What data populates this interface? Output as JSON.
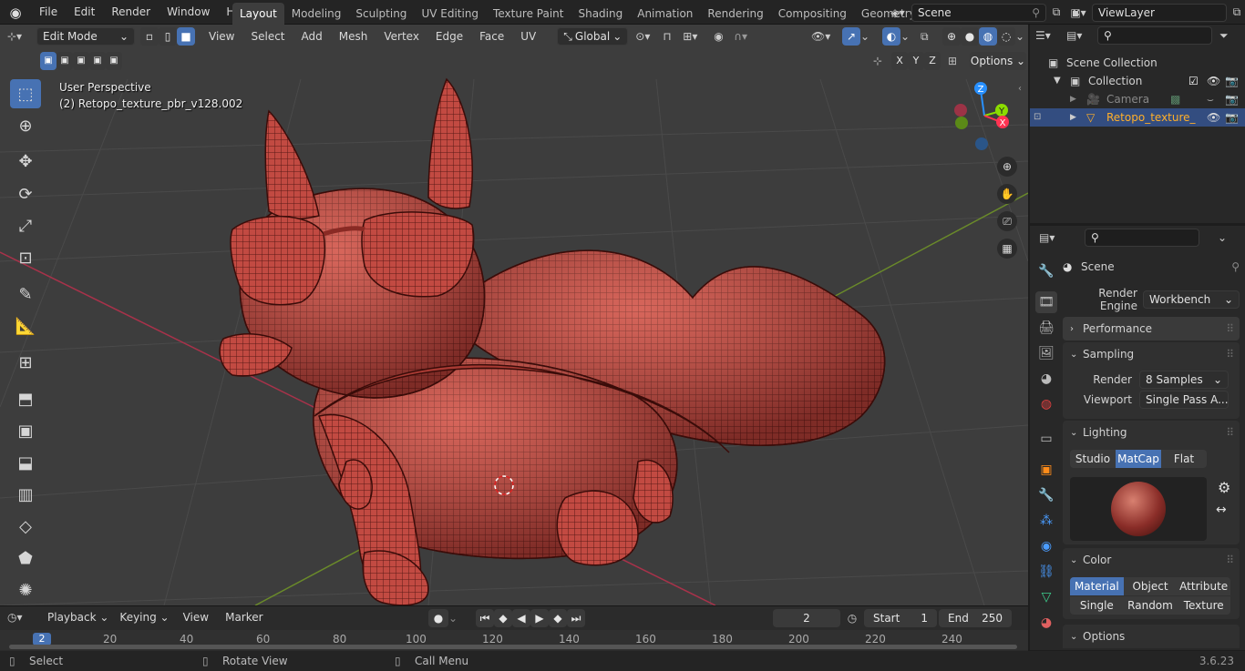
{
  "menu": {
    "items": [
      "File",
      "Edit",
      "Render",
      "Window",
      "Help"
    ]
  },
  "workspaces": {
    "tabs": [
      "Layout",
      "Modeling",
      "Sculpting",
      "UV Editing",
      "Texture Paint",
      "Shading",
      "Animation",
      "Rendering",
      "Compositing",
      "Geometry Noc"
    ],
    "active": "Layout"
  },
  "scene": {
    "name": "Scene",
    "view_layer": "ViewLayer"
  },
  "viewport_header": {
    "mode": "Edit Mode",
    "menus": [
      "View",
      "Select",
      "Add",
      "Mesh",
      "Vertex",
      "Edge",
      "Face",
      "UV"
    ],
    "orientation": "Global",
    "options": "Options",
    "axes": [
      "X",
      "Y",
      "Z"
    ]
  },
  "viewport": {
    "perspective": "User Perspective",
    "object_label": "(2) Retopo_texture_pbr_v128.002"
  },
  "gizmo": {
    "axes": [
      "Z",
      "Y",
      "X"
    ]
  },
  "outliner": {
    "root": "Scene Collection",
    "collection": "Collection",
    "camera": "Camera",
    "mesh": "Retopo_texture_"
  },
  "properties": {
    "breadcrumb": "Scene",
    "render_engine_label": "Render Engine",
    "render_engine": "Workbench",
    "performance": "Performance",
    "sampling": "Sampling",
    "render_label": "Render",
    "render_samples": "8 Samples",
    "viewport_label": "Viewport",
    "viewport_samples": "Single Pass A...",
    "lighting": "Lighting",
    "lighting_modes": [
      "Studio",
      "MatCap",
      "Flat"
    ],
    "lighting_active": "MatCap",
    "color": "Color",
    "color_modes_row1": [
      "Material",
      "Object",
      "Attribute"
    ],
    "color_modes_row2": [
      "Single",
      "Random",
      "Texture"
    ],
    "color_active": "Material",
    "options": "Options"
  },
  "timeline": {
    "menus": [
      "Playback",
      "Keying",
      "View",
      "Marker"
    ],
    "current_frame": "2",
    "start_label": "Start",
    "start": "1",
    "end_label": "End",
    "end": "250",
    "ruler": [
      "20",
      "40",
      "60",
      "80",
      "100",
      "120",
      "140",
      "160",
      "180",
      "200",
      "220",
      "240"
    ],
    "playhead": "2"
  },
  "status": {
    "select": "Select",
    "rotate": "Rotate View",
    "call_menu": "Call Menu",
    "version": "3.6.23"
  },
  "colors": {
    "accent": "#4772b3",
    "mesh": "#c0453e",
    "x_axis": "#ff3352",
    "y_axis": "#8bdc00",
    "z_axis": "#2890ff",
    "orange": "#ffaf29"
  }
}
